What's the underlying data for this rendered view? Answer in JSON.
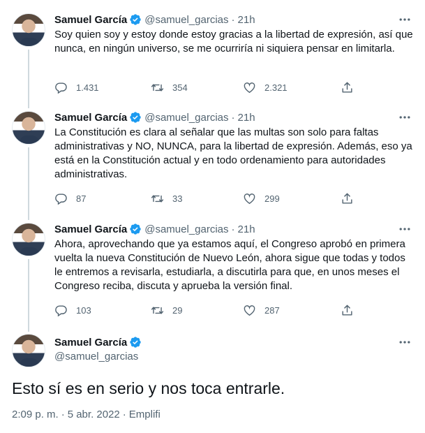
{
  "author": {
    "name": "Samuel García",
    "handle": "@samuel_garcias"
  },
  "tweets": [
    {
      "time": "21h",
      "text": "Soy quien soy y estoy donde estoy gracias a la libertad de expresión, así que nunca, en ningún universo, se me ocurriría ni siquiera pensar en limitarla.",
      "replies": "1.431",
      "retweets": "354",
      "likes": "2.321"
    },
    {
      "time": "21h",
      "text": "La Constitución es clara al señalar que las multas son solo para faltas administrativas y NO, NUNCA, para la libertad de expresión. Además, eso ya está en la Constitución actual y en todo ordenamiento para autoridades administrativas.",
      "replies": "87",
      "retweets": "33",
      "likes": "299"
    },
    {
      "time": "21h",
      "text": "Ahora, aprovechando que ya estamos aquí, el Congreso aprobó en primera vuelta la nueva Constitución de Nuevo León, ahora sigue que todas y todos le entremos a revisarla, estudiarla, a discutirla para que, en unos meses el Congreso reciba, discuta y aprueba la versión final.",
      "replies": "103",
      "retweets": "29",
      "likes": "287"
    }
  ],
  "main_tweet": {
    "text": "Esto sí es en serio y nos toca entrarle.",
    "time": "2:09 p. m.",
    "date": "5 abr. 2022",
    "source": "Emplifi",
    "separator": "·"
  },
  "colors": {
    "text": "#0f1419",
    "secondary": "#536471",
    "verified": "#1d9bf0",
    "thread_line": "#cfd9de"
  },
  "icons": [
    "reply-icon",
    "retweet-icon",
    "like-icon",
    "share-icon",
    "more-icon",
    "verified-badge-icon"
  ]
}
